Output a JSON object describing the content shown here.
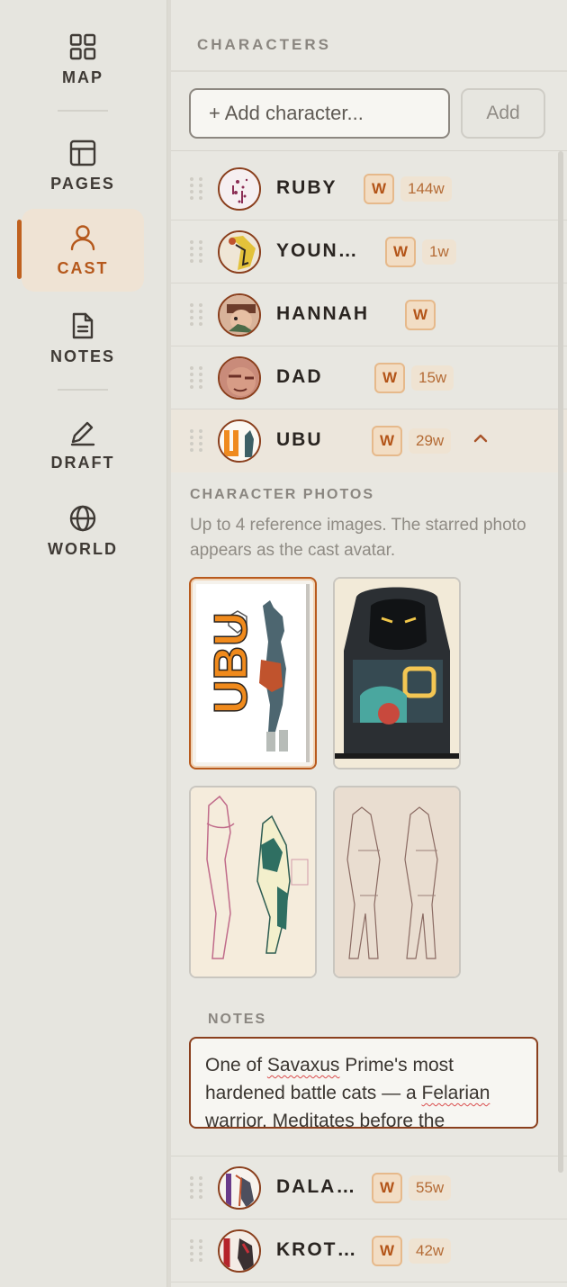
{
  "nav": {
    "items": [
      {
        "label": "MAP",
        "icon": "grid-icon"
      },
      {
        "label": "PAGES",
        "icon": "layout-icon"
      },
      {
        "label": "CAST",
        "icon": "person-icon",
        "active": true
      },
      {
        "label": "NOTES",
        "icon": "document-icon"
      },
      {
        "label": "DRAFT",
        "icon": "pencil-icon"
      },
      {
        "label": "WORLD",
        "icon": "globe-icon"
      }
    ]
  },
  "characters": {
    "title": "CHARACTERS",
    "add_placeholder": "+ Add character...",
    "add_button": "Add",
    "rows": [
      {
        "name": "RUBY",
        "badge": "W",
        "count": "144w"
      },
      {
        "name": "YOUN…",
        "badge": "W",
        "count": "1w"
      },
      {
        "name": "HANNAH",
        "badge": "W",
        "count": ""
      },
      {
        "name": "DAD",
        "badge": "W",
        "count": "15w"
      },
      {
        "name": "UBU",
        "badge": "W",
        "count": "29w",
        "expanded": true
      },
      {
        "name": "DALA…",
        "badge": "W",
        "count": "55w"
      },
      {
        "name": "KROT…",
        "badge": "W",
        "count": "42w"
      }
    ]
  },
  "detail": {
    "photos_title": "CHARACTER PHOTOS",
    "photos_desc": "Up to 4 reference images. The starred photo appears as the cast avatar.",
    "photo_logo_text": "UBU",
    "notes_title": "NOTES",
    "notes_parts": [
      "One of ",
      "Savaxus",
      " Prime's most hardened battle cats — a ",
      "Felarian",
      " warrior. Meditates before the"
    ]
  },
  "colors": {
    "accent": "#c0611f",
    "badge_bg": "#f2ddc4",
    "panel_bg": "#e8e7e1"
  }
}
